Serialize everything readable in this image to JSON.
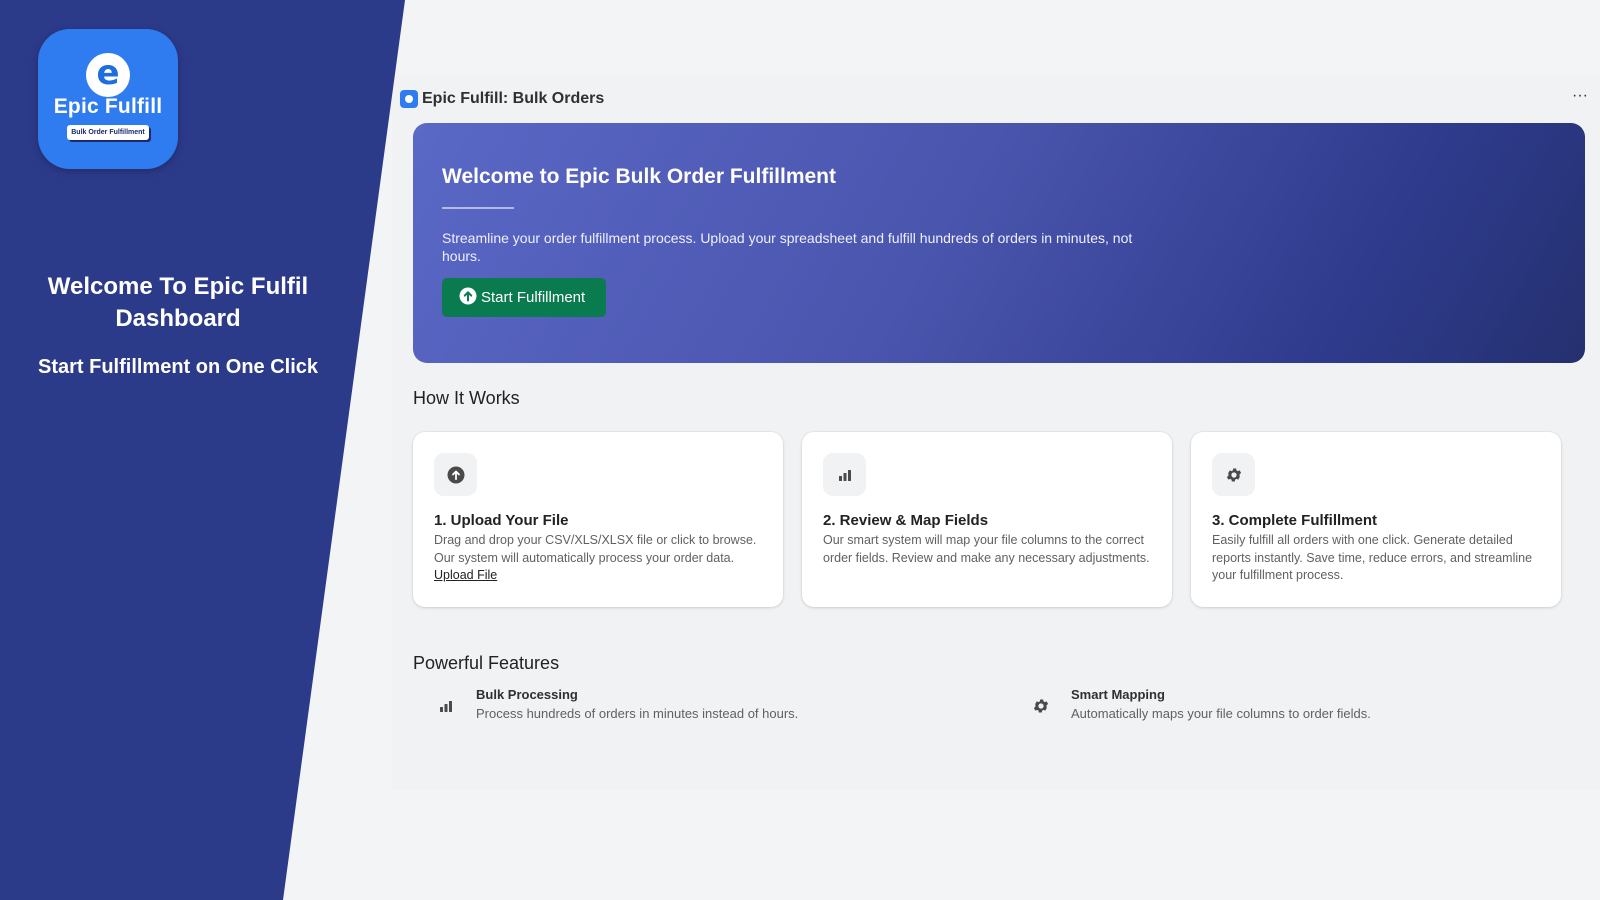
{
  "promo": {
    "logo_name": "Epic Fulfill",
    "logo_tagline": "Bulk Order Fulfillment",
    "title": "Welcome To Epic Fulfil Dashboard",
    "subtitle": "Start Fulfillment on One Click"
  },
  "app": {
    "title": "Epic Fulfill: Bulk Orders",
    "more_icon": "more-horizontal-icon",
    "more_glyph": "···"
  },
  "hero": {
    "title": "Welcome to Epic Bulk Order Fulfillment",
    "description": "Streamline your order fulfillment process. Upload your spreadsheet and fulfill hundreds of orders in minutes, not hours.",
    "button_label": "Start Fulfillment",
    "button_icon": "upload-arrow-icon",
    "colors": {
      "gradient_start": "#5a68c6",
      "gradient_end": "#25306f",
      "button": "#0a7a4f"
    }
  },
  "how_it_works": {
    "title": "How It Works",
    "steps": [
      {
        "icon": "upload-arrow-icon",
        "title": "1. Upload Your File",
        "description": "Drag and drop your CSV/XLS/XLSX file or click to browse. Our system will automatically process your order data.",
        "link": "Upload File"
      },
      {
        "icon": "bar-chart-icon",
        "title": "2. Review & Map Fields",
        "description": "Our smart system will map your file columns to the correct order fields. Review and make any necessary adjustments."
      },
      {
        "icon": "gear-icon",
        "title": "3. Complete Fulfillment",
        "description": "Easily fulfill all orders with one click. Generate detailed reports instantly. Save time, reduce errors, and streamline your fulfillment process."
      }
    ]
  },
  "features": {
    "title": "Powerful Features",
    "items": [
      {
        "icon": "bar-chart-icon",
        "title": "Bulk Processing",
        "description": "Process hundreds of orders in minutes instead of hours."
      },
      {
        "icon": "gear-icon",
        "title": "Smart Mapping",
        "description": "Automatically maps your file columns to order fields."
      }
    ]
  },
  "colors": {
    "promo_panel": "#2c3a8a",
    "logo_tile": "#2f7cf0",
    "page_background": "#f3f4f6"
  }
}
